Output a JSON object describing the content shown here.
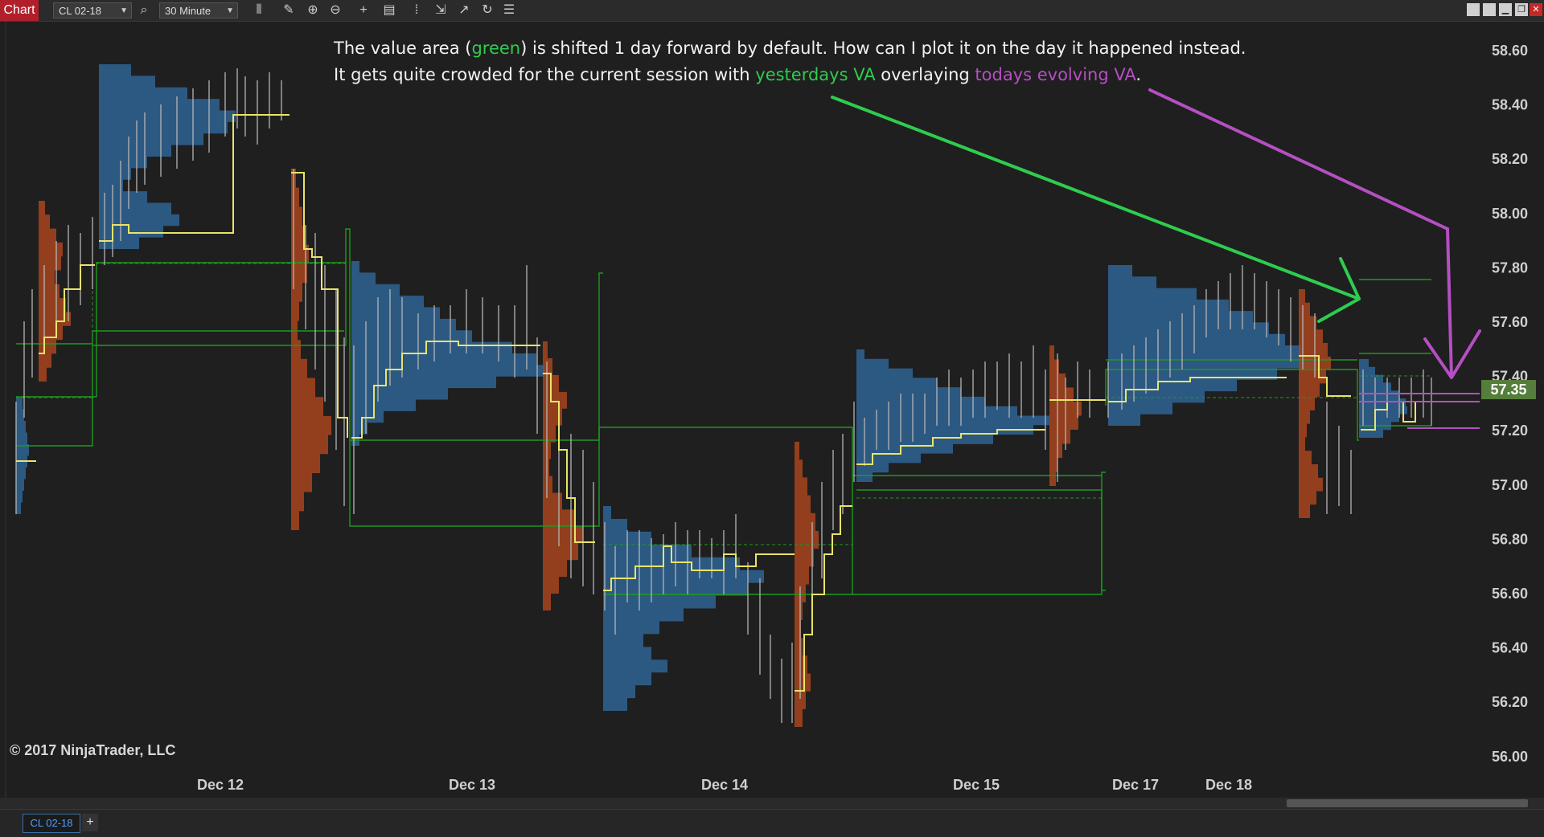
{
  "toolbar": {
    "chart_tab": "Chart",
    "instrument": "CL 02-18",
    "interval": "30 Minute",
    "icons": [
      "search-icon",
      "bar-type-icon",
      "draw-pencil-icon",
      "zoom-in-icon",
      "zoom-out-icon",
      "crosshair-icon",
      "properties-icon",
      "indicators-icon",
      "strategies-icon",
      "drawing-tools-icon",
      "reload-icon",
      "list-icon"
    ]
  },
  "window_buttons": [
    "minimize",
    "restore",
    "maximize",
    "close"
  ],
  "annotation": {
    "line1_a": "The value area (",
    "line1_green": "green",
    "line1_b": ") is shifted 1 day forward by default. How can I plot it on the day it happened instead.",
    "line2_a": "It gets quite crowded for the current session with ",
    "line2_green": "yesterdays VA",
    "line2_b": " overlaying ",
    "line2_purple": "todays evolving VA",
    "line2_c": ".",
    "green_color": "#2ecc4f",
    "purple_color": "#b54fc2"
  },
  "price_axis": {
    "labels": [
      "58.60",
      "58.40",
      "58.20",
      "58.00",
      "57.80",
      "57.60",
      "57.40",
      "57.20",
      "57.00",
      "56.80",
      "56.60",
      "56.40",
      "56.20",
      "56.00"
    ],
    "current_price": "57.35"
  },
  "date_axis": {
    "labels": [
      "Dec 12",
      "Dec 13",
      "Dec 14",
      "Dec 15",
      "Dec 17",
      "Dec 18"
    ]
  },
  "copyright": "© 2017 NinjaTrader, LLC",
  "bottom_tabs": {
    "instrument_tab": "CL 02-18",
    "add_tab": "+"
  },
  "colors": {
    "background": "#1f1f1f",
    "blue_profile": "#2f6494",
    "orange_profile": "#a8451f",
    "poc_line": "#e9e36a",
    "va_line": "#1e9a1e",
    "candle": "#b5b5b5",
    "arrow_green": "#2ecc4f",
    "arrow_purple": "#b54fc2"
  }
}
